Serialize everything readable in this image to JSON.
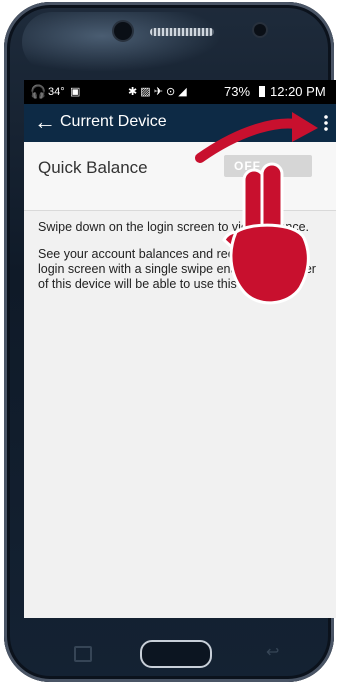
{
  "status_bar": {
    "temperature": "34°",
    "battery": "73%",
    "time": "12:20 PM"
  },
  "app_bar": {
    "back_icon": "arrow-left-icon",
    "title": "Current Device",
    "menu_icon": "overflow-menu-icon"
  },
  "setting": {
    "label": "Quick Balance",
    "toggle_state": "OFF"
  },
  "info": {
    "paragraph1": "Swipe down on the login screen to view Balance.",
    "paragraph2": "See your account balances and recent from the login screen with a single swipe enabled, any user of this device will be able to use this feature."
  },
  "colors": {
    "app_bar": "#0d2a45",
    "annotation": "#c8102e",
    "toggle_off": "#d6d6d6"
  },
  "annotation": {
    "arrow_icon": "curved-arrow-icon",
    "hand_icon": "tapping-hand-icon"
  }
}
